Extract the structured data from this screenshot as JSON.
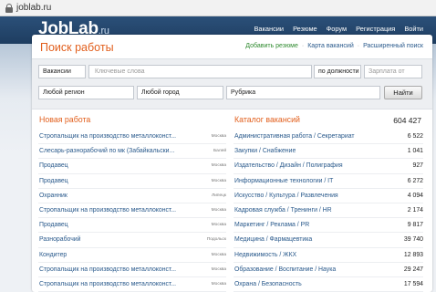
{
  "browser": {
    "url": "joblab.ru"
  },
  "header": {
    "logo": "JobLab",
    "logo_suffix": ".ru",
    "nav": [
      "Вакансии",
      "Резюме",
      "Форум",
      "Регистрация",
      "Войти"
    ]
  },
  "search": {
    "title": "Поиск работы",
    "link_add_resume": "Добавить резюме",
    "link_map": "Карта вакансий",
    "link_advanced": "Расширенный поиск",
    "type_value": "Вакансии",
    "keywords_placeholder": "Ключевые слова",
    "by_position_value": "по должности",
    "salary_placeholder": "Зарплата от",
    "region_value": "Любой регион",
    "city_value": "Любой город",
    "rubric_value": "Рубрика",
    "submit_label": "Найти"
  },
  "new_jobs": {
    "title": "Новая работа",
    "items": [
      {
        "title": "Стропальщик на производство металлоконст...",
        "city": "Москва"
      },
      {
        "title": "Слесарь-разнорабочий по мк (Забайкальски...",
        "city": "Балей"
      },
      {
        "title": "Продавец",
        "city": "Москва"
      },
      {
        "title": "Продавец",
        "city": "Москва"
      },
      {
        "title": "Охранник",
        "city": "Липецк"
      },
      {
        "title": "Стропальщик на производство металлоконст...",
        "city": "Москва"
      },
      {
        "title": "Продавец",
        "city": "Москва"
      },
      {
        "title": "Разнорабочий",
        "city": "Подольск"
      },
      {
        "title": "Кондитер",
        "city": "Москва"
      },
      {
        "title": "Стропальщик на производство металлоконст...",
        "city": "Москва"
      },
      {
        "title": "Стропальщик на производство металлоконст...",
        "city": "Москва"
      }
    ]
  },
  "catalog": {
    "title": "Каталог вакансий",
    "total": "604 427",
    "items": [
      {
        "name": "Административная работа / Секретариат",
        "count": "6 522"
      },
      {
        "name": "Закупки / Снабжение",
        "count": "1 041"
      },
      {
        "name": "Издательство / Дизайн / Полиграфия",
        "count": "927"
      },
      {
        "name": "Информационные технологии / IT",
        "count": "6 272"
      },
      {
        "name": "Искусство / Культура / Развлечения",
        "count": "4 094"
      },
      {
        "name": "Кадровая служба / Тренинги / HR",
        "count": "2 174"
      },
      {
        "name": "Маркетинг / Реклама / PR",
        "count": "9 817"
      },
      {
        "name": "Медицина / Фармацевтика",
        "count": "39 740"
      },
      {
        "name": "Недвижимость / ЖКХ",
        "count": "12 893"
      },
      {
        "name": "Образование / Воспитание / Наука",
        "count": "29 247"
      },
      {
        "name": "Охрана / Безопасность",
        "count": "17 594"
      }
    ]
  }
}
